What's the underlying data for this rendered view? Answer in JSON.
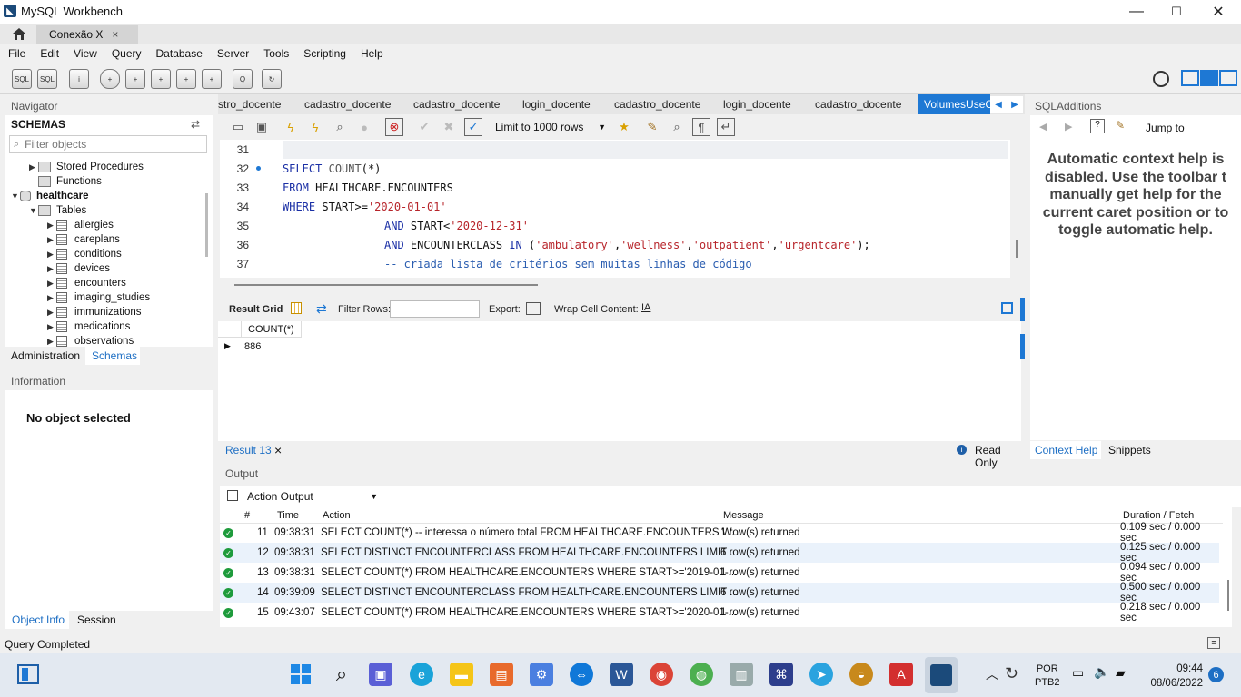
{
  "window": {
    "title": "MySQL Workbench",
    "minimize": "—",
    "maximize": "☐",
    "close": "✕"
  },
  "connection_tab": {
    "label": "Conexão X",
    "close": "×"
  },
  "menu": [
    "File",
    "Edit",
    "View",
    "Query",
    "Database",
    "Server",
    "Tools",
    "Scripting",
    "Help"
  ],
  "navigator": {
    "header": "Navigator",
    "schemas_title": "SCHEMAS",
    "filter_placeholder": "Filter objects",
    "tree": {
      "stored_procedures": "Stored Procedures",
      "functions": "Functions",
      "schema": "healthcare",
      "tables": "Tables",
      "table_items": [
        "allergies",
        "careplans",
        "conditions",
        "devices",
        "encounters",
        "imaging_studies",
        "immunizations",
        "medications",
        "observations"
      ]
    },
    "tabs": {
      "administration": "Administration",
      "schemas": "Schemas"
    }
  },
  "information": {
    "header": "Information",
    "empty": "No object selected",
    "tabs": {
      "object_info": "Object Info",
      "session": "Session"
    }
  },
  "query_tabs": [
    {
      "label": "stro_docente"
    },
    {
      "label": "cadastro_docente"
    },
    {
      "label": "cadastro_docente"
    },
    {
      "label": "login_docente"
    },
    {
      "label": "cadastro_docente"
    },
    {
      "label": "login_docente"
    },
    {
      "label": "cadastro_docente"
    },
    {
      "label": "VolumesUseC"
    }
  ],
  "sql_toolbar": {
    "limit": "Limit to 1000 rows"
  },
  "editor": {
    "line_numbers": [
      "31",
      "32",
      "33",
      "34",
      "35",
      "36",
      "37"
    ],
    "l32": {
      "kw": "SELECT",
      "fn": "COUNT",
      "rest": "(*)"
    },
    "l33": {
      "kw": "FROM",
      "rest": "HEALTHCARE.ENCOUNTERS"
    },
    "l34": {
      "kw": "WHERE",
      "mid": "START>=",
      "str": "'2020-01-01'"
    },
    "l35": {
      "kw": "AND",
      "mid": "START<",
      "str": "'2020-12-31'"
    },
    "l36": {
      "kw1": "AND",
      "mid": "ENCOUNTERCLASS",
      "kw2": "IN",
      "p1": "(",
      "s1": "'ambulatory'",
      "s2": "'wellness'",
      "s3": "'outpatient'",
      "s4": "'urgentcare'",
      "p2": ");"
    },
    "l37": {
      "comment": "-- criada lista de critérios sem muitas linhas de código"
    }
  },
  "result_toolbar": {
    "grid": "Result Grid",
    "filter": "Filter Rows:",
    "export": "Export:",
    "wrap": "Wrap Cell Content:"
  },
  "result_grid": {
    "column": "COUNT(*)",
    "value": "886"
  },
  "result_footer": {
    "tab": "Result 13",
    "close": "×",
    "readonly": "Read Only"
  },
  "sql_additions": {
    "header": "SQLAdditions",
    "jump": "Jump to",
    "help": [
      "Automatic context help is",
      "disabled. Use the toolbar t",
      "manually get help for the",
      "current caret position or to",
      "toggle automatic help."
    ],
    "tabs": {
      "context_help": "Context Help",
      "snippets": "Snippets"
    }
  },
  "output": {
    "header": "Output",
    "selector": "Action Output",
    "columns": {
      "num": "#",
      "time": "Time",
      "action": "Action",
      "message": "Message",
      "duration": "Duration / Fetch"
    },
    "rows": [
      {
        "num": "11",
        "time": "09:38:31",
        "action": "SELECT COUNT(*) -- interessa o número total  FROM HEALTHCARE.ENCOUNTERS W...",
        "message": "1 row(s) returned",
        "duration": "0.109 sec / 0.000 sec"
      },
      {
        "num": "12",
        "time": "09:38:31",
        "action": "SELECT DISTINCT ENCOUNTERCLASS FROM HEALTHCARE.ENCOUNTERS LIMIT ...",
        "message": "6 row(s) returned",
        "duration": "0.125 sec / 0.000 sec"
      },
      {
        "num": "13",
        "time": "09:38:31",
        "action": "SELECT COUNT(*) FROM HEALTHCARE.ENCOUNTERS WHERE START>='2019-01-...",
        "message": "1 row(s) returned",
        "duration": "0.094 sec / 0.000 sec"
      },
      {
        "num": "14",
        "time": "09:39:09",
        "action": "SELECT DISTINCT ENCOUNTERCLASS FROM HEALTHCARE.ENCOUNTERS LIMIT ...",
        "message": "6 row(s) returned",
        "duration": "0.500 sec / 0.000 sec"
      },
      {
        "num": "15",
        "time": "09:43:07",
        "action": "SELECT COUNT(*) FROM HEALTHCARE.ENCOUNTERS WHERE START>='2020-01-...",
        "message": "1 row(s) returned",
        "duration": "0.218 sec / 0.000 sec"
      }
    ]
  },
  "status": {
    "text": "Query Completed"
  },
  "taskbar": {
    "lang": "POR",
    "layout": "PTB2",
    "time": "09:44",
    "date": "08/06/2022",
    "notifications": "6"
  }
}
